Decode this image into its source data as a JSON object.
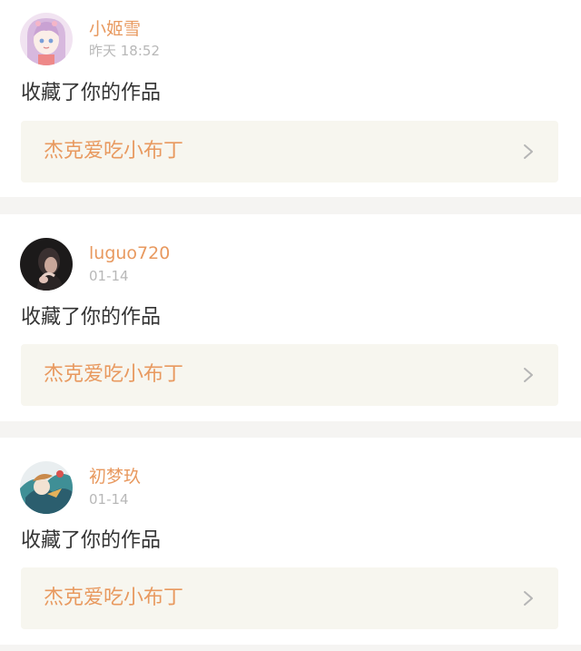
{
  "notifications": [
    {
      "username": "小姬雪",
      "time": "昨天 18:52",
      "action": "收藏了你的作品",
      "work_title": "杰克爱吃小布丁",
      "avatar_icon": "anime-girl-avatar",
      "chevron_icon": "chevron-right-icon"
    },
    {
      "username": "luguo720",
      "time": "01-14",
      "action": "收藏了你的作品",
      "work_title": "杰克爱吃小布丁",
      "avatar_icon": "dark-photo-avatar",
      "chevron_icon": "chevron-right-icon"
    },
    {
      "username": "初梦玖",
      "time": "01-14",
      "action": "收藏了你的作品",
      "work_title": "杰克爱吃小布丁",
      "avatar_icon": "illustration-avatar",
      "chevron_icon": "chevron-right-icon"
    }
  ],
  "colors": {
    "accent": "#e8995f",
    "muted": "#b8b8b8",
    "text": "#333333",
    "card_bg": "#ffffff",
    "page_bg": "#f5f4f2",
    "link_bg": "#f7f6ef"
  }
}
